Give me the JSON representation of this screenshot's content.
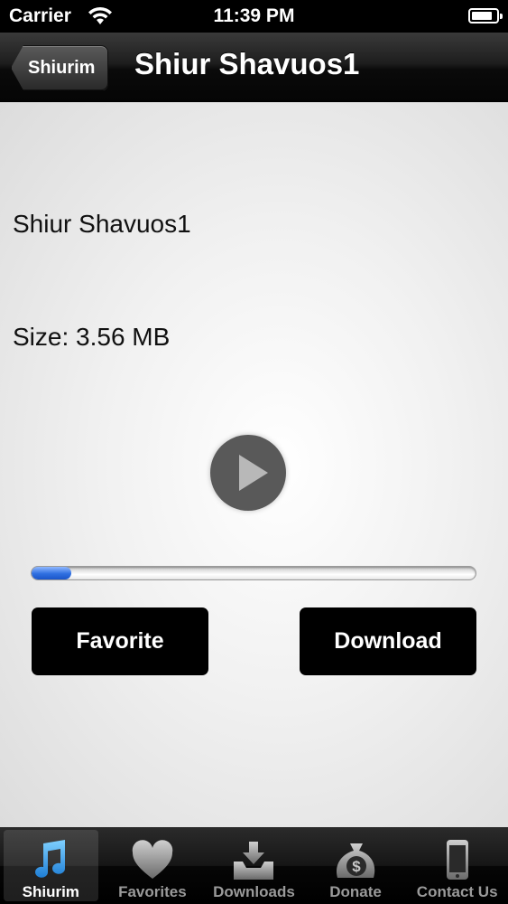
{
  "status_bar": {
    "carrier": "Carrier",
    "time": "11:39 PM",
    "battery_level": 0.85
  },
  "nav": {
    "back_label": "Shiurim",
    "title": "Shiur Shavuos1"
  },
  "content": {
    "shiur_name": "Shiur Shavuos1",
    "size_text": "Size: 3.56 MB",
    "progress": 0.09,
    "favorite_label": "Favorite",
    "download_label": "Download"
  },
  "tabs": [
    {
      "label": "Shiurim",
      "icon": "music-note-icon",
      "active": true
    },
    {
      "label": "Favorites",
      "icon": "heart-icon",
      "active": false
    },
    {
      "label": "Downloads",
      "icon": "download-tray-icon",
      "active": false
    },
    {
      "label": "Donate",
      "icon": "dollar-bag-icon",
      "active": false
    },
    {
      "label": "Contact Us",
      "icon": "phone-icon",
      "active": false
    }
  ],
  "colors": {
    "tab_active_icon": "#3aa0e6",
    "progress_fill": "#2f6fe0"
  }
}
